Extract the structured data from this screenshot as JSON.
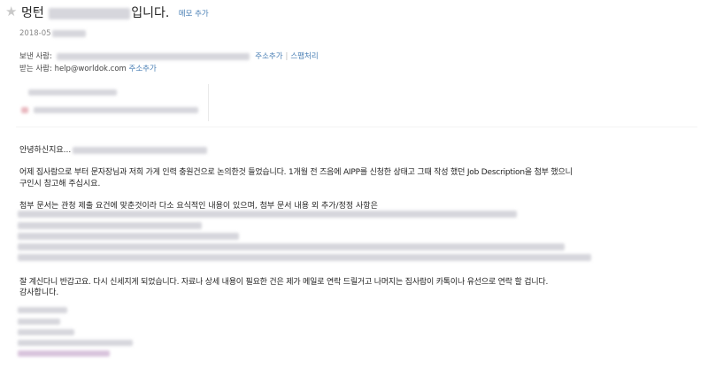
{
  "header": {
    "subject_prefix": "멍턴",
    "subject_suffix": "입니다.",
    "memo_add": "메모 추가",
    "date_prefix": "2018-05"
  },
  "sender": {
    "label": "보낸 사람:",
    "add_address": "주소추가",
    "spam": "스팸처리"
  },
  "recipient": {
    "label": "받는 사람:",
    "email": "help@worldok.com",
    "add_address": "주소추가"
  },
  "body": {
    "greeting": "안녕하신지요...",
    "para1_line1": "어제 집사람으로 부터 문자장님과 저희 가게 인력 충원건으로 논의한것 들었습니다. 1개월 전 즈음에 AIPP를 신청한 상태고 그때 작성 했던 Job Description을 첨부 했으니",
    "para1_line2": "구인시 참고해 주십시요.",
    "para2_intro": "첨부 문서는 관청 제출 요건에 맞춘것이라 다소 요식적인 내용이 있으며, 첨부 문서 내용 외 추가/정정 사항은",
    "para3_line1": "잘 계신다니 반갑고요. 다시 신세지게 되었습니다.  자료나 상세 내용이 필요한 건은 제가 메일로 연락 드릴거고 나머지는 집사람이 카톡이나 유선으로 연락 할 겁니다.",
    "para3_line2": "감사합니다."
  }
}
